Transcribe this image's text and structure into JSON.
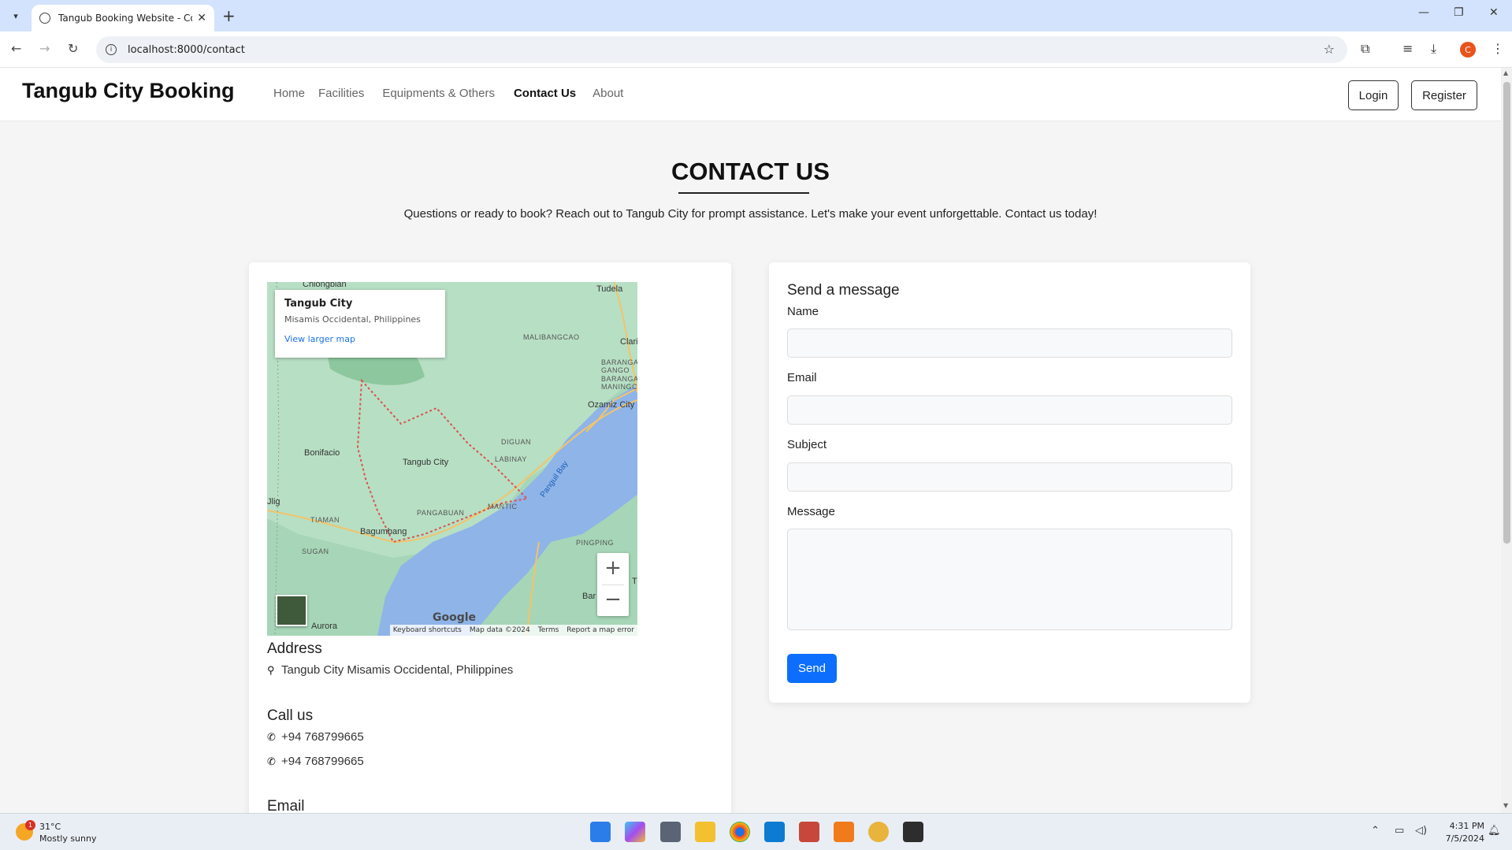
{
  "browser": {
    "tab_title": "Tangub Booking Website - Contact",
    "url": "localhost:8000/contact",
    "profile_initial": "C"
  },
  "site": {
    "brand": "Tangub City Booking",
    "nav": [
      "Home",
      "Facilities",
      "Equipments & Others",
      "Contact Us",
      "About"
    ],
    "active_nav": "Contact Us",
    "login_label": "Login",
    "register_label": "Register"
  },
  "page": {
    "heading": "CONTACT US",
    "intro": "Questions or ready to book? Reach out to Tangub City for prompt assistance. Let's make your event unforgettable. Contact us today!"
  },
  "map": {
    "card_title": "Tangub City",
    "card_subtitle": "Misamis Occidental, Philippines",
    "card_link": "View larger map",
    "labels": [
      "Chiongbian",
      "Tudela",
      "MALIBANGCAO",
      "Clari",
      "BARANGA GANGO",
      "BARANGA MANINGC",
      "Ozamiz City",
      "DIGUAN",
      "Bonifacio",
      "Tangub City",
      "LABINAY",
      "Panguil Bay",
      "Jlig",
      "PANGABUAN",
      "MANTIC",
      "TIAMAN",
      "Bagumbang",
      "SUGAN",
      "PINGPING",
      "Bar",
      "Aurora",
      "T"
    ],
    "google_logo": "Google",
    "footer": [
      "Keyboard shortcuts",
      "Map data ©2024",
      "Terms",
      "Report a map error"
    ],
    "zoom_in": "+",
    "zoom_out": "−"
  },
  "contact_info": {
    "address_heading": "Address",
    "address": "Tangub City Misamis Occidental, Philippines",
    "call_heading": "Call us",
    "phones": [
      "+94 768799665",
      "+94 768799665"
    ],
    "email_heading": "Email"
  },
  "form": {
    "title": "Send a message",
    "name_label": "Name",
    "email_label": "Email",
    "subject_label": "Subject",
    "message_label": "Message",
    "send_label": "Send"
  },
  "taskbar": {
    "temperature": "31°C",
    "weather": "Mostly sunny",
    "weather_badge": "1",
    "time": "4:31 PM",
    "date": "7/5/2024"
  },
  "colors": {
    "primary": "#0d6efd",
    "map_water": "#8fb4e8",
    "map_land": "#a6d6b7"
  }
}
